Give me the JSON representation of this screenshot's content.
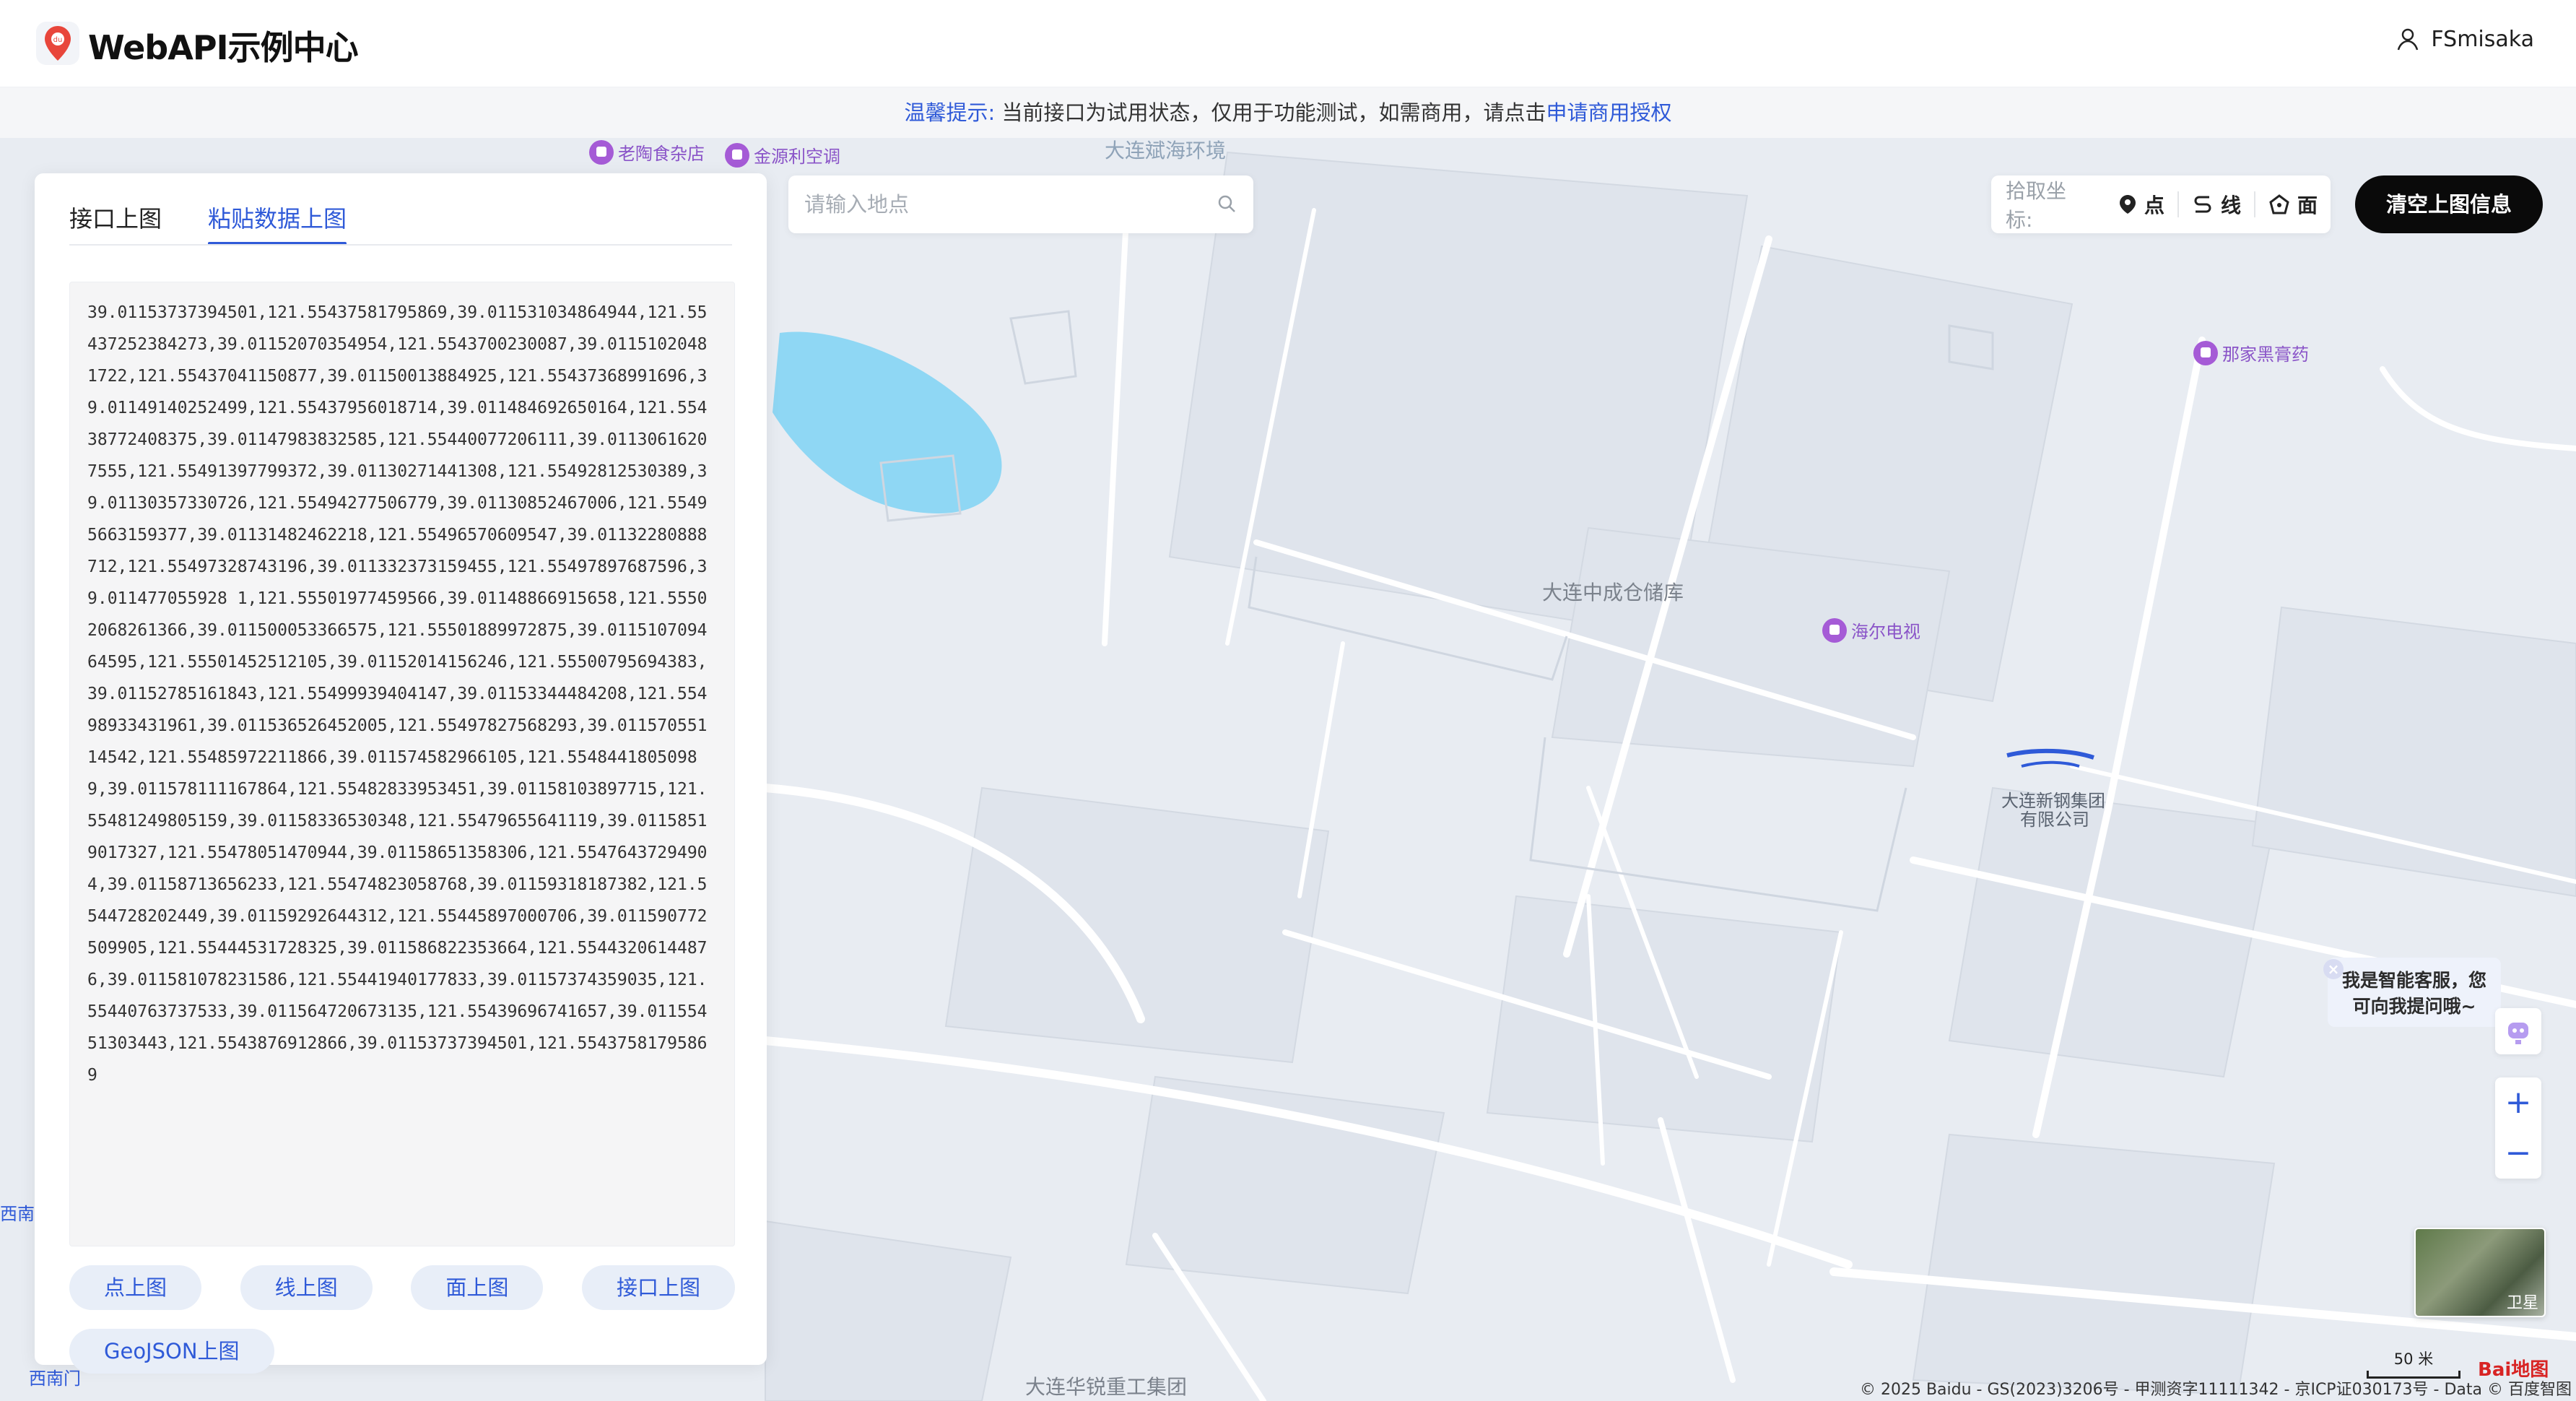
{
  "header": {
    "brand": "WebAPI示例中心",
    "username": "FSmisaka"
  },
  "notice": {
    "prefix": "温馨提示:",
    "body": " 当前接口为试用状态，仅用于功能测试，如需商用，请点击",
    "link": "申请商用授权"
  },
  "panel": {
    "tabs": [
      {
        "label": "接口上图",
        "active": false
      },
      {
        "label": "粘贴数据上图",
        "active": true
      }
    ],
    "textarea_value": "39.01153737394501,121.55437581795869,39.011531034864944,121.55437252384273,39.01152070354954,121.5543700230087,39.01151020481722,121.55437041150877,39.01150013884925,121.55437368991696,39.01149140252499,121.55437956018714,39.011484692650164,121.55438772408375,39.01147983832585,121.55440077206111,39.01130616207555,121.55491397799372,39.01130271441308,121.55492812530389,39.01130357330726,121.55494277506779,39.01130852467006,121.55495663159377,39.01131482462218,121.55496570609547,39.01132280888712,121.55497328743196,39.011332373159455,121.55497897687596,39.011477055928 1,121.55501977459566,39.01148866915658,121.55502068261366,39.011500053366575,121.55501889972875,39.011510709464595,121.55501452512105,39.01152014156246,121.55500795694383,39.01152785161843,121.55499939404147,39.01153344484208,121.55498933431961,39.011536526452005,121.55497827568293,39.01157055114542,121.55485972211866,39.011574582966105,121.55484418050989,39.011578111167864,121.55482833953451,39.01158103897715,121.55481249805159,39.01158336530348,121.55479655641119,39.01158519017327,121.55478051470944,39.01158651358306,121.55476437294904,39.01158713656233,121.55474823058768,39.01159318187382,121.5544728202449,39.01159292644312,121.55445897000706,39.011590772509905,121.55444531728325,39.011586822353664,121.55443206144876,39.011581078231586,121.55441940177833,39.01157374359035,121.55440763737533,39.011564720673135,121.55439696741657,39.01155451303443,121.5543876912866,39.01153737394501,121.55437581795869",
    "buttons": [
      "点上图",
      "线上图",
      "面上图",
      "接口上图"
    ],
    "geojson_button": "GeoJSON上图"
  },
  "search": {
    "placeholder": "请输入地点"
  },
  "pick": {
    "label": "拾取坐标:",
    "point": "点",
    "line": "线",
    "area": "面"
  },
  "clear_button": "清空上图信息",
  "assistant": {
    "line1": "我是智能客服，您",
    "line2": "可向我提问哦~"
  },
  "zoom": {
    "plus": "+",
    "minus": "−"
  },
  "satellite_label": "卫星",
  "scale_label": "50 米",
  "copyright": "© 2025 Baidu - GS(2023)3206号 - 甲测资字11111342 - 京ICP证030173号 - Data © 百度智图",
  "baidu_logo": "Bai地图",
  "map_pois": [
    {
      "name": "老陶食杂店"
    },
    {
      "name": "金源利空调"
    },
    {
      "name": "那家黑膏药"
    },
    {
      "name": "海尔电视"
    }
  ],
  "map_labels": {
    "warehouse": "大连中成仓储库",
    "steel_1": "大连新钢集团",
    "steel_2": "有限公司",
    "huarui": "大连华锐重工集团",
    "env_1": "大连斌海环境",
    "southwest": "西南",
    "southwest_gate": "西南门"
  }
}
